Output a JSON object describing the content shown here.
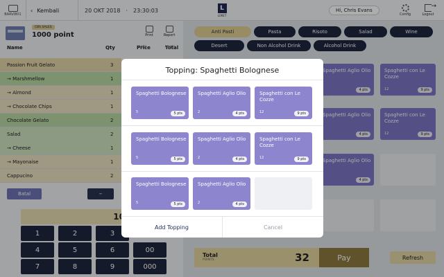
{
  "topbar": {
    "device_code": "BARVI801",
    "back_label": "Kembali",
    "date": "20 OKT 2018",
    "time": "23:30:03",
    "logo_text": "LOKET",
    "user_greeting": "Hi, Chris Evans",
    "config_label": "Config",
    "logout_label": "Logout"
  },
  "customer": {
    "badge": "CBS SALES",
    "points": "1000 point",
    "print_label": "Print",
    "report_label": "Report"
  },
  "order_table": {
    "headers": {
      "name": "Name",
      "qty": "Qty",
      "price": "Price",
      "price_sub": "POINTS",
      "total": "Total",
      "total_sub": "POINTS"
    },
    "rows": [
      {
        "name": "Passion Fruit Gelato",
        "qty": "3"
      },
      {
        "name": "Marshmellow",
        "qty": "1"
      },
      {
        "name": "Almond",
        "qty": "1"
      },
      {
        "name": "Chocolate Chips",
        "qty": "1"
      },
      {
        "name": "Chocolate Gelato",
        "qty": "2"
      },
      {
        "name": "Salad",
        "qty": "2"
      },
      {
        "name": "Cheese",
        "qty": "1"
      },
      {
        "name": "Mayonaise",
        "qty": "1"
      },
      {
        "name": "Cappucino",
        "qty": "2"
      }
    ],
    "arrow": "→"
  },
  "actions": {
    "batal": "Batal",
    "minus": "–"
  },
  "numpad": {
    "display": "10",
    "keys": [
      "1",
      "2",
      "3",
      "4",
      "5",
      "6",
      "7",
      "8",
      "9",
      "00",
      "000"
    ]
  },
  "categories": [
    "Anti Pasti",
    "Pasta",
    "Risoto",
    "Salad",
    "Wine",
    "Desert",
    "Non Alcohol Drink",
    "Alcohol Drink"
  ],
  "products": [
    {
      "name": "Spaghetti Aglio Olio",
      "qty": "",
      "pts": "4 pts"
    },
    {
      "name": "Spaghetti con Le Cozze",
      "qty": "12",
      "pts": "9 pts"
    },
    {
      "name": "Spaghetti Aglio Olio",
      "qty": "",
      "pts": "4 pts"
    },
    {
      "name": "Spaghetti con Le Cozze",
      "qty": "12",
      "pts": "9 pts"
    },
    {
      "name": "Spaghetti Aglio Olio",
      "qty": "",
      "pts": "4 pts"
    }
  ],
  "total": {
    "label": "Total",
    "sub": "POINTS",
    "value": "32",
    "pay": "Pay",
    "refresh": "Refresh"
  },
  "modal": {
    "title": "Topping: Spaghetti Bolognese",
    "rows": [
      [
        {
          "name": "Spaghetti Bolognese",
          "qty": "5",
          "pts": "5 pts"
        },
        {
          "name": "Spaghetti Aglio Olio",
          "qty": "2",
          "pts": "4 pts"
        },
        {
          "name": "Spaghetti con Le Cozze",
          "qty": "12",
          "pts": "9 pts"
        }
      ],
      [
        {
          "name": "Spaghetti Bolognese",
          "qty": "5",
          "pts": "5 pts"
        },
        {
          "name": "Spaghetti Aglio Olio",
          "qty": "2",
          "pts": "4 pts"
        },
        {
          "name": "Spaghetti con Le Cozze",
          "qty": "12",
          "pts": "9 pts"
        }
      ],
      [
        {
          "name": "Spaghetti Bolognese",
          "qty": "5",
          "pts": "5 pts"
        },
        {
          "name": "Spaghetti Aglio Olio",
          "qty": "2",
          "pts": "4 pts"
        }
      ]
    ],
    "add_label": "Add Topping",
    "cancel_label": "Cancel"
  },
  "colors": {
    "navy": "#1f2740",
    "gold": "#e0cf94",
    "product_purple": "#7d75c4",
    "topping_purple": "#8e85cf",
    "pay_brown": "#8e7a3f"
  }
}
